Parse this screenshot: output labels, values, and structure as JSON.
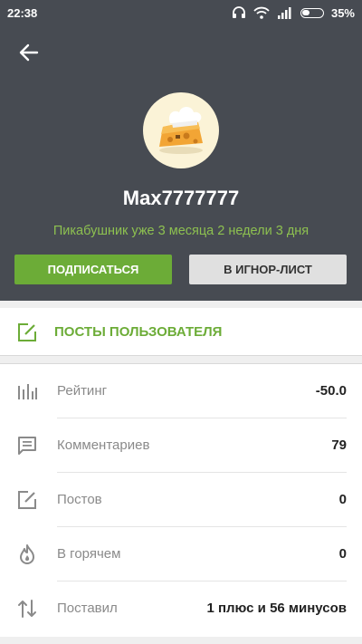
{
  "status_bar": {
    "time": "22:38",
    "battery_percent": "35%",
    "icons": [
      "headphones-icon",
      "wifi-icon",
      "signal-icon",
      "battery-icon"
    ]
  },
  "colors": {
    "header_bg": "#474b52",
    "accent_green": "#6cac37",
    "since_text": "#8dc050",
    "ignore_button": "#e0e0e0"
  },
  "profile": {
    "username": "Max7777777",
    "since": "Пикабушник уже 3 месяца 2 недели 3 дня",
    "subscribe_label": "ПОДПИСАТЬСЯ",
    "ignore_label": "В ИГНОР-ЛИСТ"
  },
  "posts_link": {
    "label": "ПОСТЫ ПОЛЬЗОВАТЕЛЯ",
    "icon": "edit-icon"
  },
  "stats": [
    {
      "label": "Рейтинг",
      "value": "-50.0",
      "icon": "bar-chart-icon"
    },
    {
      "label": "Комментариев",
      "value": "79",
      "icon": "comment-icon"
    },
    {
      "label": "Постов",
      "value": "0",
      "icon": "edit-icon"
    },
    {
      "label": "В горячем",
      "value": "0",
      "icon": "flame-icon"
    },
    {
      "label": "Поставил",
      "value": "1 плюс и 56 минусов",
      "icon": "up-down-arrows-icon"
    }
  ]
}
